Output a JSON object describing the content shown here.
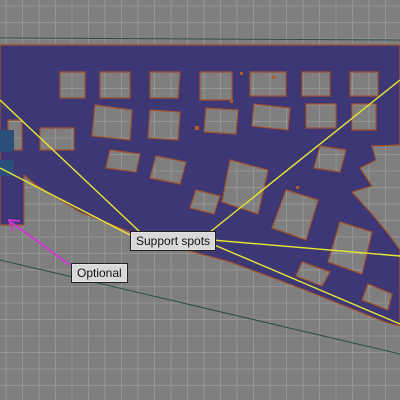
{
  "view": {
    "grid_on": true,
    "colors": {
      "background": "#808080",
      "grid": "#9a9a9a",
      "model_fill": "#3d3875",
      "model_outline": "#a0522d",
      "leader_lines": "#e6e633",
      "optional_arrow": "#d633d6",
      "horizon_line": "#2f4a4a",
      "label_background": "#d9d9d9"
    }
  },
  "annotations": {
    "support_label": "Support spots",
    "optional_label": "Optional"
  }
}
